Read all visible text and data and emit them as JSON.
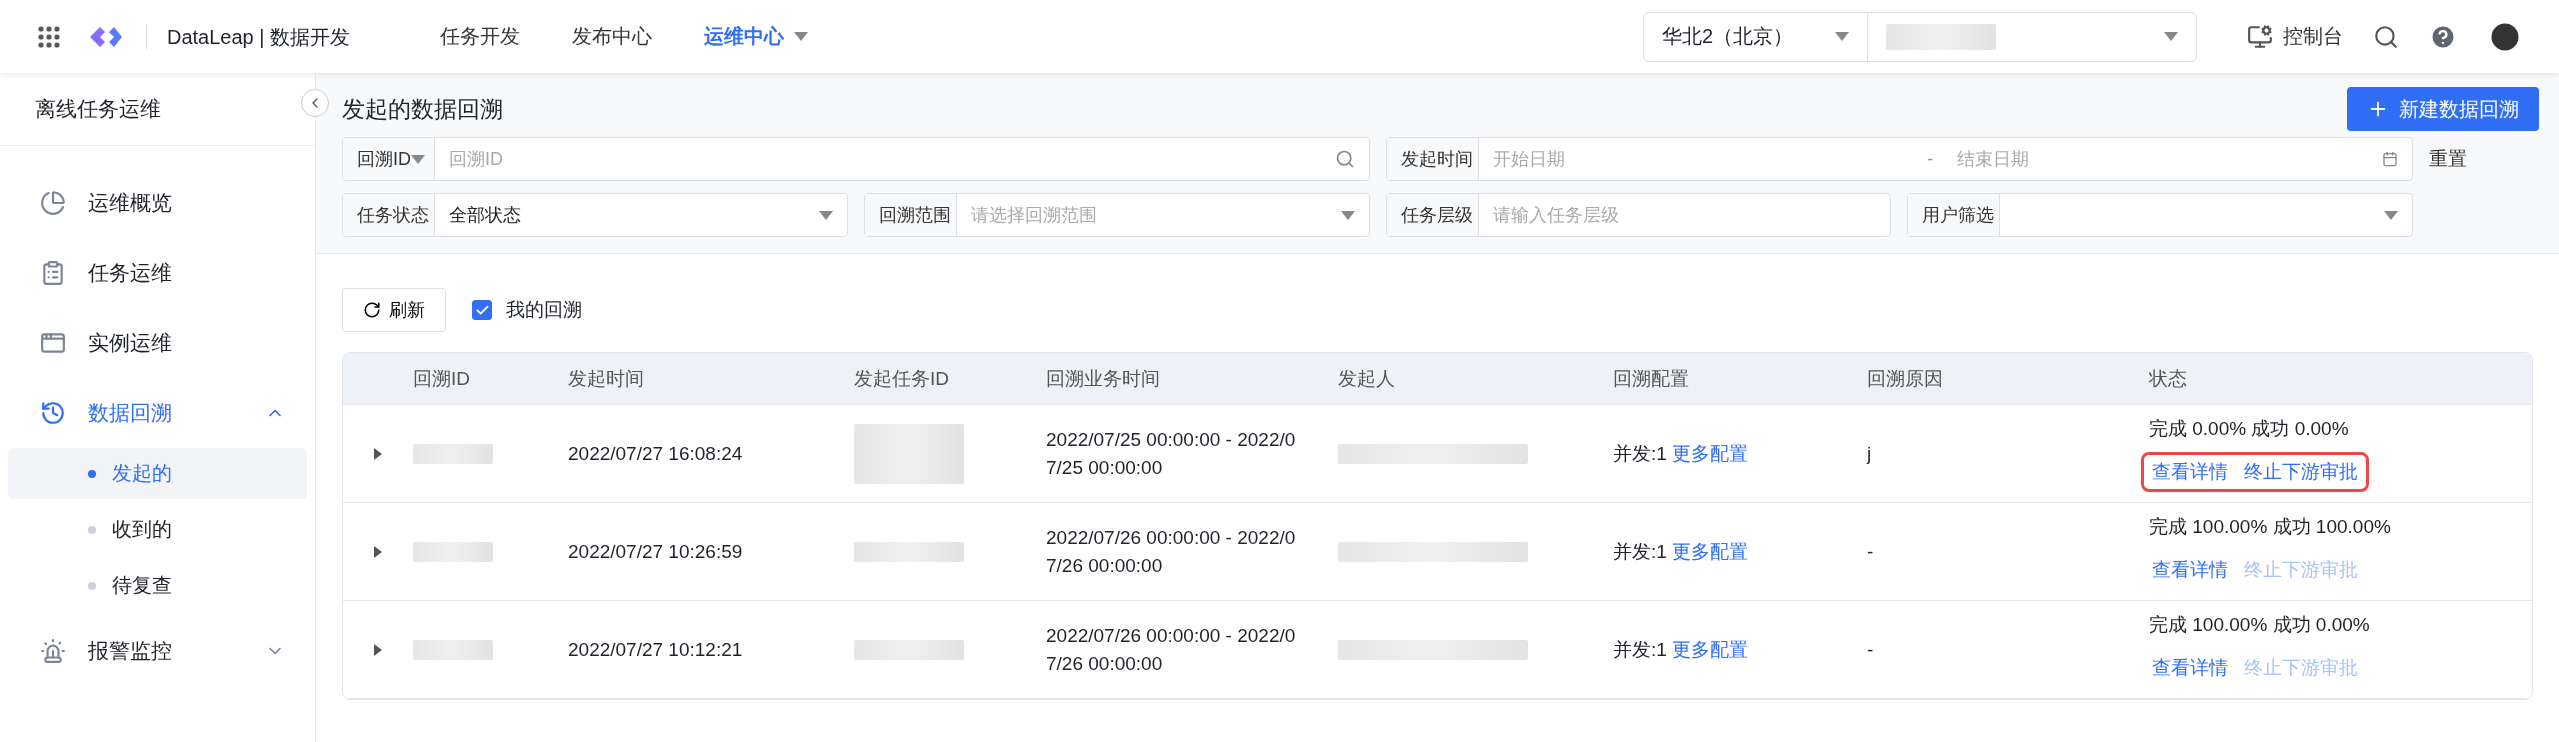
{
  "topbar": {
    "brand": "DataLeap | 数据开发",
    "nav": [
      {
        "label": "任务开发",
        "selected": false,
        "has_caret": false
      },
      {
        "label": "发布中心",
        "selected": false,
        "has_caret": false
      },
      {
        "label": "运维中心",
        "selected": true,
        "has_caret": true
      }
    ],
    "region": "华北2（北京）",
    "console": "控制台"
  },
  "sidebar": {
    "title": "离线任务运维",
    "items": [
      {
        "label": "运维概览",
        "selected": false
      },
      {
        "label": "任务运维",
        "selected": false
      },
      {
        "label": "实例运维",
        "selected": false
      },
      {
        "label": "数据回溯",
        "selected": true,
        "expanded": true,
        "children": [
          {
            "label": "发起的",
            "selected": true
          },
          {
            "label": "收到的",
            "selected": false
          },
          {
            "label": "待复查",
            "selected": false
          }
        ]
      },
      {
        "label": "报警监控",
        "selected": false,
        "expanded": false
      }
    ]
  },
  "page": {
    "title": "发起的数据回溯",
    "new_button": "新建数据回溯",
    "reset": "重置"
  },
  "filters": [
    {
      "kind": "select-search",
      "label": "回溯ID",
      "placeholder": "回溯ID"
    },
    {
      "kind": "daterange",
      "label": "发起时间",
      "placeholder": "开始日期",
      "placeholder2": "结束日期",
      "sep": "-"
    },
    {
      "kind": "select",
      "label": "任务状态",
      "value": "全部状态"
    },
    {
      "kind": "select",
      "label": "回溯范围",
      "placeholder": "请选择回溯范围"
    },
    {
      "kind": "input",
      "label": "任务层级",
      "placeholder": "请输入任务层级"
    },
    {
      "kind": "select",
      "label": "用户筛选"
    }
  ],
  "toolbar": {
    "refresh": "刷新",
    "mine": {
      "label": "我的回溯",
      "checked": true
    }
  },
  "table": {
    "columns": [
      "回溯ID",
      "发起时间",
      "发起任务ID",
      "回溯业务时间",
      "发起人",
      "回溯配置",
      "回溯原因",
      "状态"
    ],
    "rows": [
      {
        "time": "2022/07/27 16:08:24",
        "biz_time": "2022/07/25 00:00:00 - 2022/07/25 00:00:00",
        "concurrency": "并发:1",
        "more": "更多配置",
        "reason": "j",
        "status": "完成 0.00% 成功 0.00%",
        "detail": "查看详情",
        "stop": "终止下游审批",
        "stop_disabled": false,
        "highlighted": true
      },
      {
        "time": "2022/07/27 10:26:59",
        "biz_time": "2022/07/26 00:00:00 - 2022/07/26 00:00:00",
        "concurrency": "并发:1",
        "more": "更多配置",
        "reason": "-",
        "status": "完成 100.00% 成功 100.00%",
        "detail": "查看详情",
        "stop": "终止下游审批",
        "stop_disabled": true,
        "highlighted": false
      },
      {
        "time": "2022/07/27 10:12:21",
        "biz_time": "2022/07/26 00:00:00 - 2022/07/26 00:00:00",
        "concurrency": "并发:1",
        "more": "更多配置",
        "reason": "-",
        "status": "完成 100.00% 成功 0.00%",
        "detail": "查看详情",
        "stop": "终止下游审批",
        "stop_disabled": true,
        "highlighted": false
      }
    ]
  }
}
